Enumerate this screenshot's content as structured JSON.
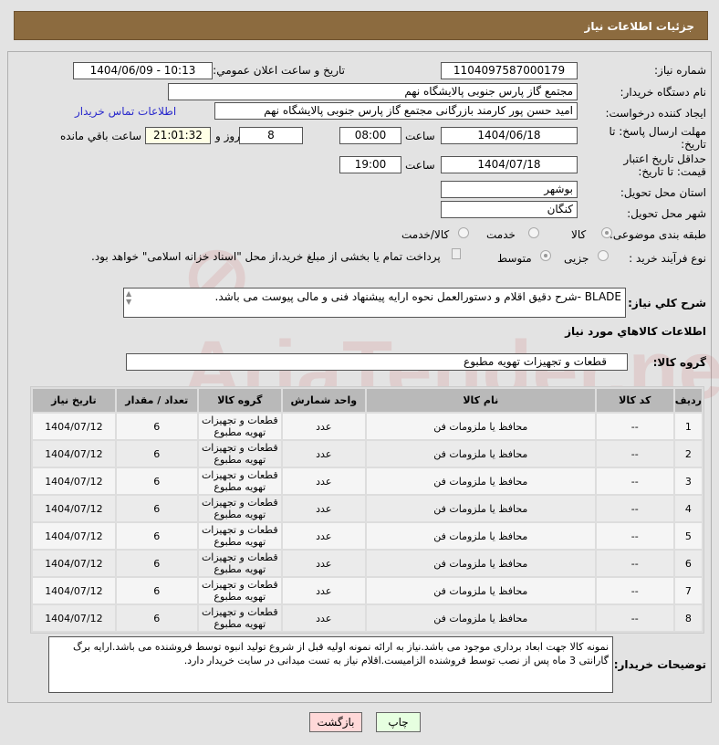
{
  "header": {
    "title": "جزئیات اطلاعات نیاز"
  },
  "form": {
    "need_number_label": "شماره نیاز:",
    "need_number": "1104097587000179",
    "announce_label": "تاریخ و ساعت اعلان عمومي:",
    "announce_value": "1404/06/09 - 10:13",
    "buyer_org_label": "نام دستگاه خريدار:",
    "buyer_org": "مجتمع گاز پارس جنوبی  پالایشگاه نهم",
    "creator_label": "ايجاد کننده درخواست:",
    "creator": "امید حسن پور کارمند بازرگانی مجتمع گاز پارس جنوبی  پالایشگاه نهم",
    "contact_link": "اطلاعات تماس خریدار",
    "deadline_label": "مهلت ارسال پاسخ: تا تاریخ:",
    "deadline_date": "1404/06/18",
    "time_label": "ساعت",
    "deadline_time": "08:00",
    "days": "8",
    "days_label": "روز و",
    "remaining": "21:01:32",
    "remaining_label": "ساعت باقي مانده",
    "validity_label": "حداقل تاریخ اعتبار قیمت: تا تاریخ:",
    "validity_date": "1404/07/18",
    "validity_time": "19:00",
    "province_label": "استان محل تحویل:",
    "province": "بوشهر",
    "city_label": "شهر محل تحویل:",
    "city": "کنگان",
    "category_label": "طبقه بندی موضوعی:",
    "cat_options": [
      "کالا",
      "خدمت",
      "کالا/خدمت"
    ],
    "process_label": "نوع فرآیند خرید :",
    "process_options": [
      "جزیی",
      "متوسط"
    ],
    "payment_note": "پرداخت تمام یا بخشی از مبلغ خرید،از محل \"اسناد خزانه اسلامی\" خواهد بود.",
    "desc_label": "شرح كلي نياز:",
    "desc": "BLADE -شرح دقیق اقلام و دستورالعمل نحوه ارایه پیشنهاد فنی و مالی پیوست می باشد.",
    "goods_info_title": "اطلاعات کالاهاي مورد نياز",
    "group_label": "گروه کالا:",
    "group": "قطعات و تجهیزات تهویه مطبوع"
  },
  "table": {
    "headers": [
      "ردیف",
      "کد کالا",
      "نام کالا",
      "واحد شمارش",
      "گروه کالا",
      "تعداد / مقدار",
      "تاریخ نیاز"
    ],
    "rows": [
      [
        "1",
        "--",
        "محافظ یا ملزومات فن",
        "عدد",
        "قطعات و تجهیزات تهویه مطبوع",
        "6",
        "1404/07/12"
      ],
      [
        "2",
        "--",
        "محافظ یا ملزومات فن",
        "عدد",
        "قطعات و تجهیزات تهویه مطبوع",
        "6",
        "1404/07/12"
      ],
      [
        "3",
        "--",
        "محافظ یا ملزومات فن",
        "عدد",
        "قطعات و تجهیزات تهویه مطبوع",
        "6",
        "1404/07/12"
      ],
      [
        "4",
        "--",
        "محافظ یا ملزومات فن",
        "عدد",
        "قطعات و تجهیزات تهویه مطبوع",
        "6",
        "1404/07/12"
      ],
      [
        "5",
        "--",
        "محافظ یا ملزومات فن",
        "عدد",
        "قطعات و تجهیزات تهویه مطبوع",
        "6",
        "1404/07/12"
      ],
      [
        "6",
        "--",
        "محافظ یا ملزومات فن",
        "عدد",
        "قطعات و تجهیزات تهویه مطبوع",
        "6",
        "1404/07/12"
      ],
      [
        "7",
        "--",
        "محافظ یا ملزومات فن",
        "عدد",
        "قطعات و تجهیزات تهویه مطبوع",
        "6",
        "1404/07/12"
      ],
      [
        "8",
        "--",
        "محافظ یا ملزومات فن",
        "عدد",
        "قطعات و تجهیزات تهویه مطبوع",
        "6",
        "1404/07/12"
      ]
    ]
  },
  "notes": {
    "label": "توضیحات خریدار:",
    "text": "نمونه کالا جهت ابعاد برداری موجود می باشد.نیاز به ارائه نمونه اولیه قبل از شروع تولید انبوه توسط فروشنده می باشد.ارایه برگ گارانتی 3 ماه پس از نصب توسط فروشنده الزامیست.اقلام نیاز به تست میدانی در سایت خریدار دارد."
  },
  "buttons": {
    "print": "چاپ",
    "back": "بازگشت"
  },
  "watermark": "AriaTender.net"
}
